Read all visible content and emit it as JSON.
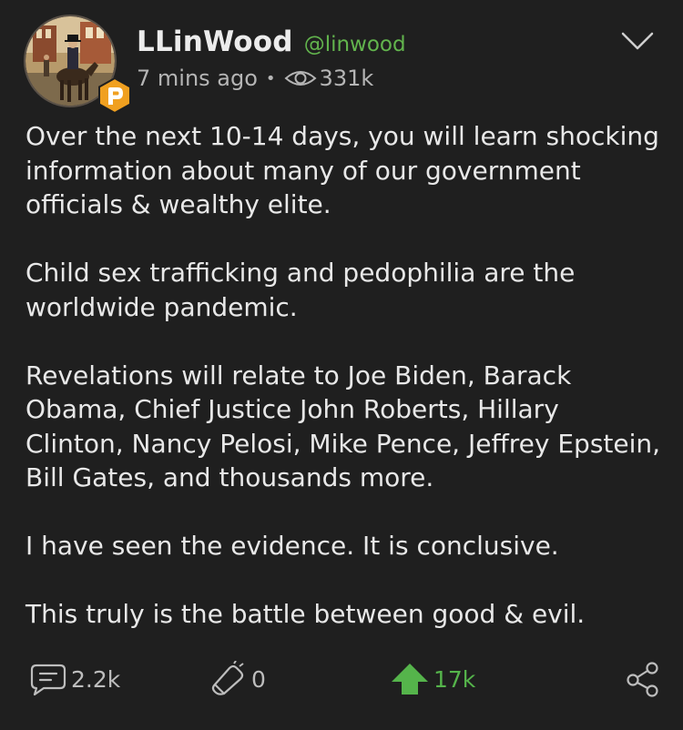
{
  "post": {
    "author": {
      "display_name": "LLinWood",
      "handle": "@linwood",
      "avatar_icon": "avatar-photo",
      "badge_icon": "parler-badge-icon"
    },
    "meta": {
      "time_ago": "7 mins ago",
      "separator": "•",
      "views_icon": "eye-icon",
      "views": "331k"
    },
    "body": {
      "paragraphs": [
        "Over the next 10-14 days, you will learn shocking information about many of our government officials & wealthy elite.",
        "Child sex trafficking and pedophilia are the worldwide pandemic.",
        "Revelations will relate to Joe Biden, Barack Obama, Chief Justice John Roberts, Hillary Clinton, Nancy Pelosi, Mike Pence, Jeffrey Epstein, Bill Gates, and thousands more.",
        "I have seen the evidence. It is conclusive.",
        "This truly is the battle between good & evil."
      ]
    },
    "actions": {
      "comments": {
        "icon": "comment-icon",
        "count": "2.2k"
      },
      "echoes": {
        "icon": "megaphone-icon",
        "count": "0"
      },
      "upvotes": {
        "icon": "upvote-arrow-icon",
        "count": "17k"
      },
      "share": {
        "icon": "share-icon"
      }
    },
    "menu_icon": "chevron-down-icon"
  },
  "colors": {
    "background": "#1f1f1f",
    "text": "#e8e8e8",
    "handle_green": "#62b44d",
    "upvote_green": "#55b44b",
    "badge_orange": "#f0a020",
    "muted": "#b5b5b5"
  }
}
